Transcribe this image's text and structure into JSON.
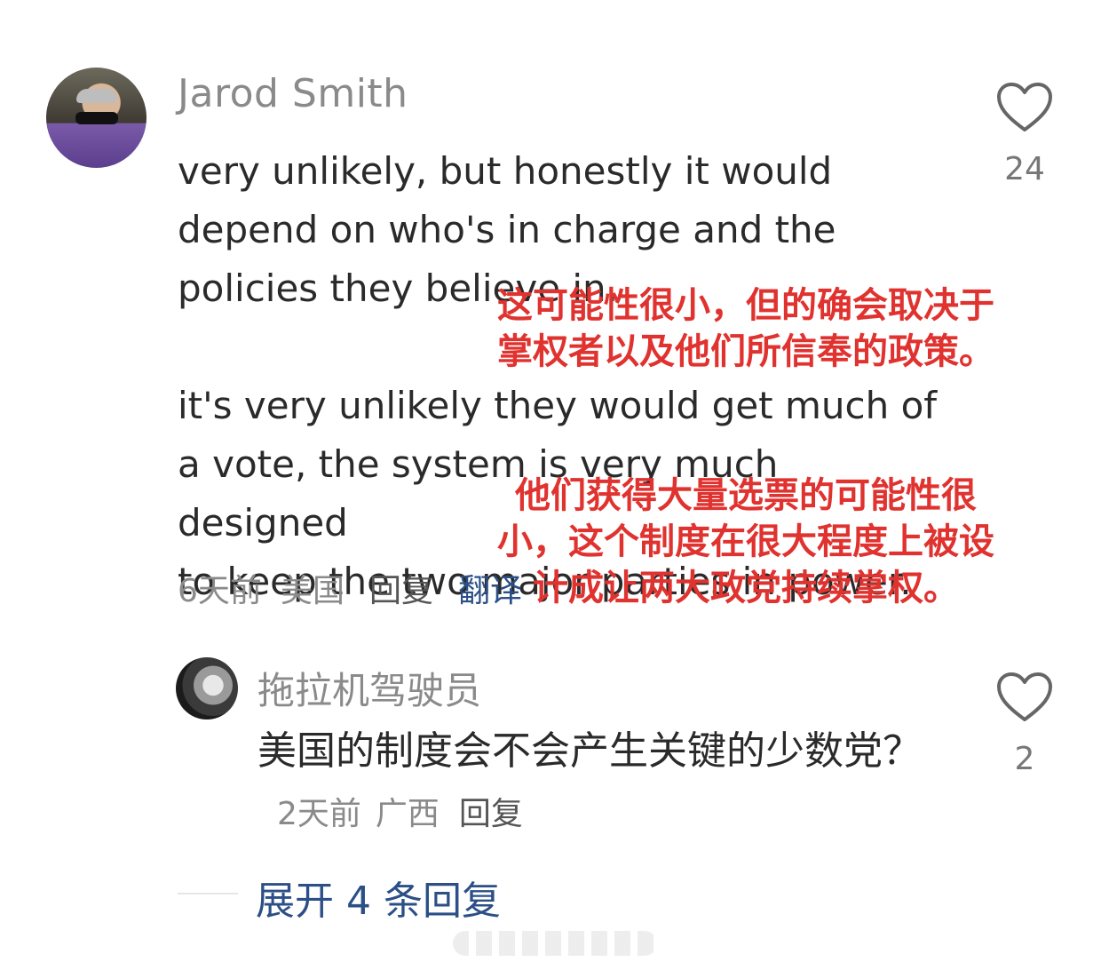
{
  "comment": {
    "username": "Jarod Smith",
    "text": "very unlikely, but honestly it would\ndepend on who's in charge and the\npolicies they believe in.\n\nit's very unlikely they would get much of\na vote, the system is very much designed\nto keep the two major parties in power.",
    "time": "6天前",
    "location": "美国",
    "reply_label": "回复",
    "translate_label": "翻译",
    "likes": "24"
  },
  "reply": {
    "username": "拖拉机驾驶员",
    "text": "美国的制度会不会产生关键的少数党？",
    "time": "2天前",
    "location": "广西",
    "reply_label": "回复",
    "likes": "2"
  },
  "expand_label": "展开 4 条回复",
  "overlay": {
    "translation_1": "这可能性很小，但的确会取决于掌权者以及他们所信奉的政策。",
    "translation_2": "他们获得大量选票的可能性很小，这个制度在很大程度上被设计成让两大政党持续掌权。"
  },
  "colors": {
    "link": "#2b4f86",
    "overlay_text": "#e0322f",
    "muted": "#8a8a8a"
  },
  "icons": {
    "like": "heart-outline-icon"
  }
}
